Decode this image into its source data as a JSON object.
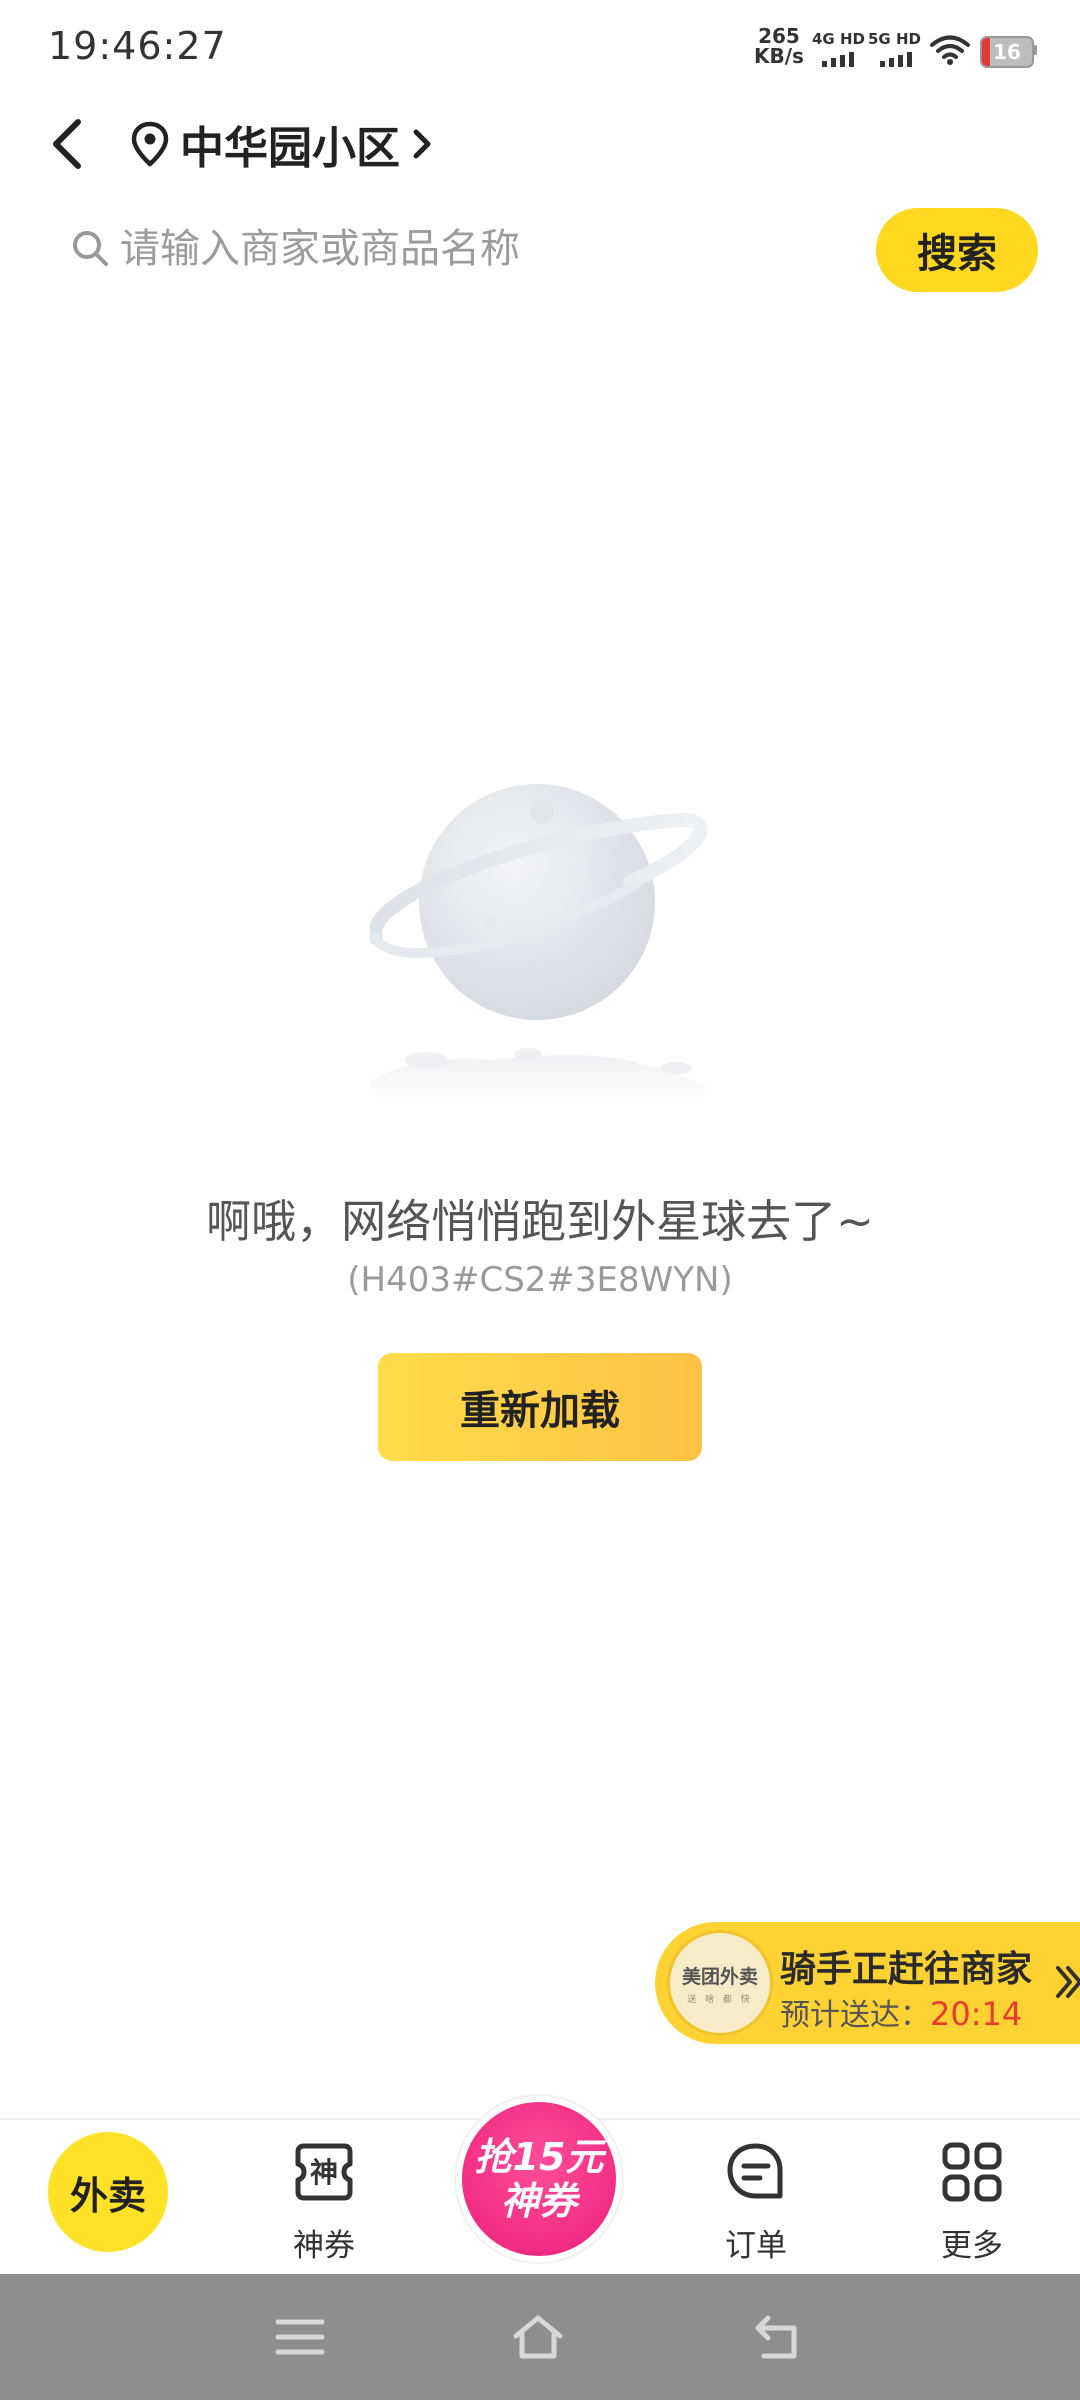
{
  "status_bar": {
    "time": "19:46:27",
    "net_speed_value": "265",
    "net_speed_unit": "KB/s",
    "sim1": "4G HD",
    "sim2": "5G HD",
    "battery": "16",
    "battery_level": 0.16
  },
  "header": {
    "location": "中华园小区"
  },
  "search": {
    "placeholder": "请输入商家或商品名称",
    "button": "搜索"
  },
  "empty_state": {
    "message": "啊哦，网络悄悄跑到外星球去了~",
    "error_code": "(H403#CS2#3E8WYN)",
    "reload_button": "重新加载"
  },
  "rider_card": {
    "logo_text": "美团外卖",
    "logo_sub": "送 啥 都 快",
    "title": "骑手正赶往商家",
    "eta_label": "预计送达：",
    "eta_time": "20:14"
  },
  "bottom_nav": {
    "waimai": "外卖",
    "coupon": "神券",
    "promo_line1": "抢15元",
    "promo_line2": "神券",
    "orders": "订单",
    "more": "更多"
  },
  "colors": {
    "accent_yellow": "#FFD81F",
    "promo_pink": "#EC1F78",
    "eta_red": "#E83A2E"
  }
}
